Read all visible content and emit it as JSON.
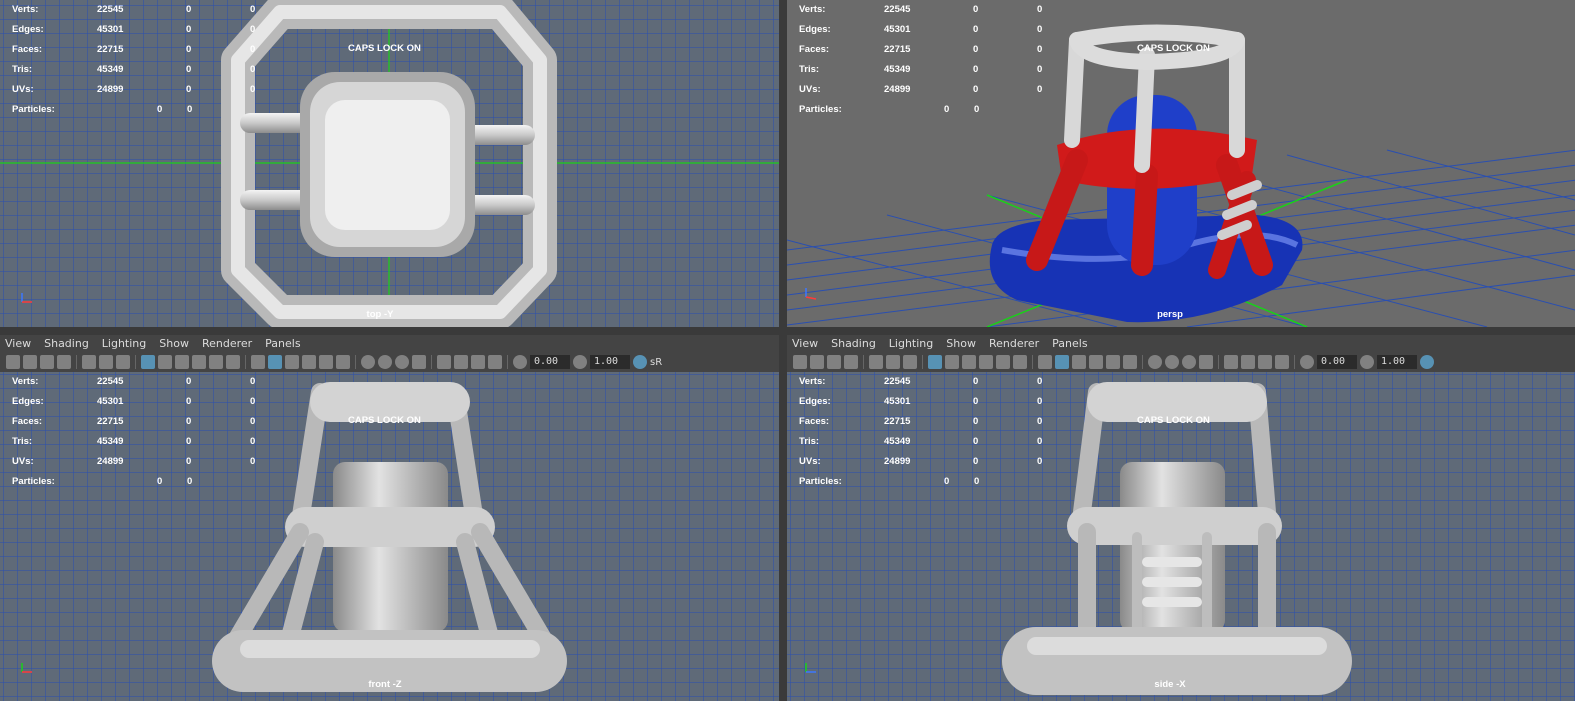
{
  "hud": {
    "rows": [
      {
        "label": "Verts:",
        "value": "22545",
        "a": "0",
        "b": "0"
      },
      {
        "label": "Edges:",
        "value": "45301",
        "a": "0",
        "b": "0"
      },
      {
        "label": "Faces:",
        "value": "22715",
        "a": "0",
        "b": "0"
      },
      {
        "label": "Tris:",
        "value": "45349",
        "a": "0",
        "b": "0"
      },
      {
        "label": "UVs:",
        "value": "24899",
        "a": "0",
        "b": "0"
      }
    ],
    "particles": {
      "label": "Particles:",
      "a": "0",
      "b": "0"
    }
  },
  "caps_lock": "CAPS LOCK ON",
  "cameras": {
    "top": "top -Y",
    "persp": "persp",
    "front": "front -Z",
    "side": "side -X"
  },
  "panel_menu": [
    "View",
    "Shading",
    "Lighting",
    "Show",
    "Renderer",
    "Panels"
  ],
  "toolbar": {
    "field1": "0.00",
    "field2": "1.00",
    "srgb": "sR"
  },
  "colors": {
    "grid_bg": "#5f6a78",
    "grid_line": "#2a4fb0",
    "axis_green": "#19d119",
    "model_white": "#cfcfcf",
    "model_red": "#d11a1a",
    "model_blue": "#1733b5"
  }
}
